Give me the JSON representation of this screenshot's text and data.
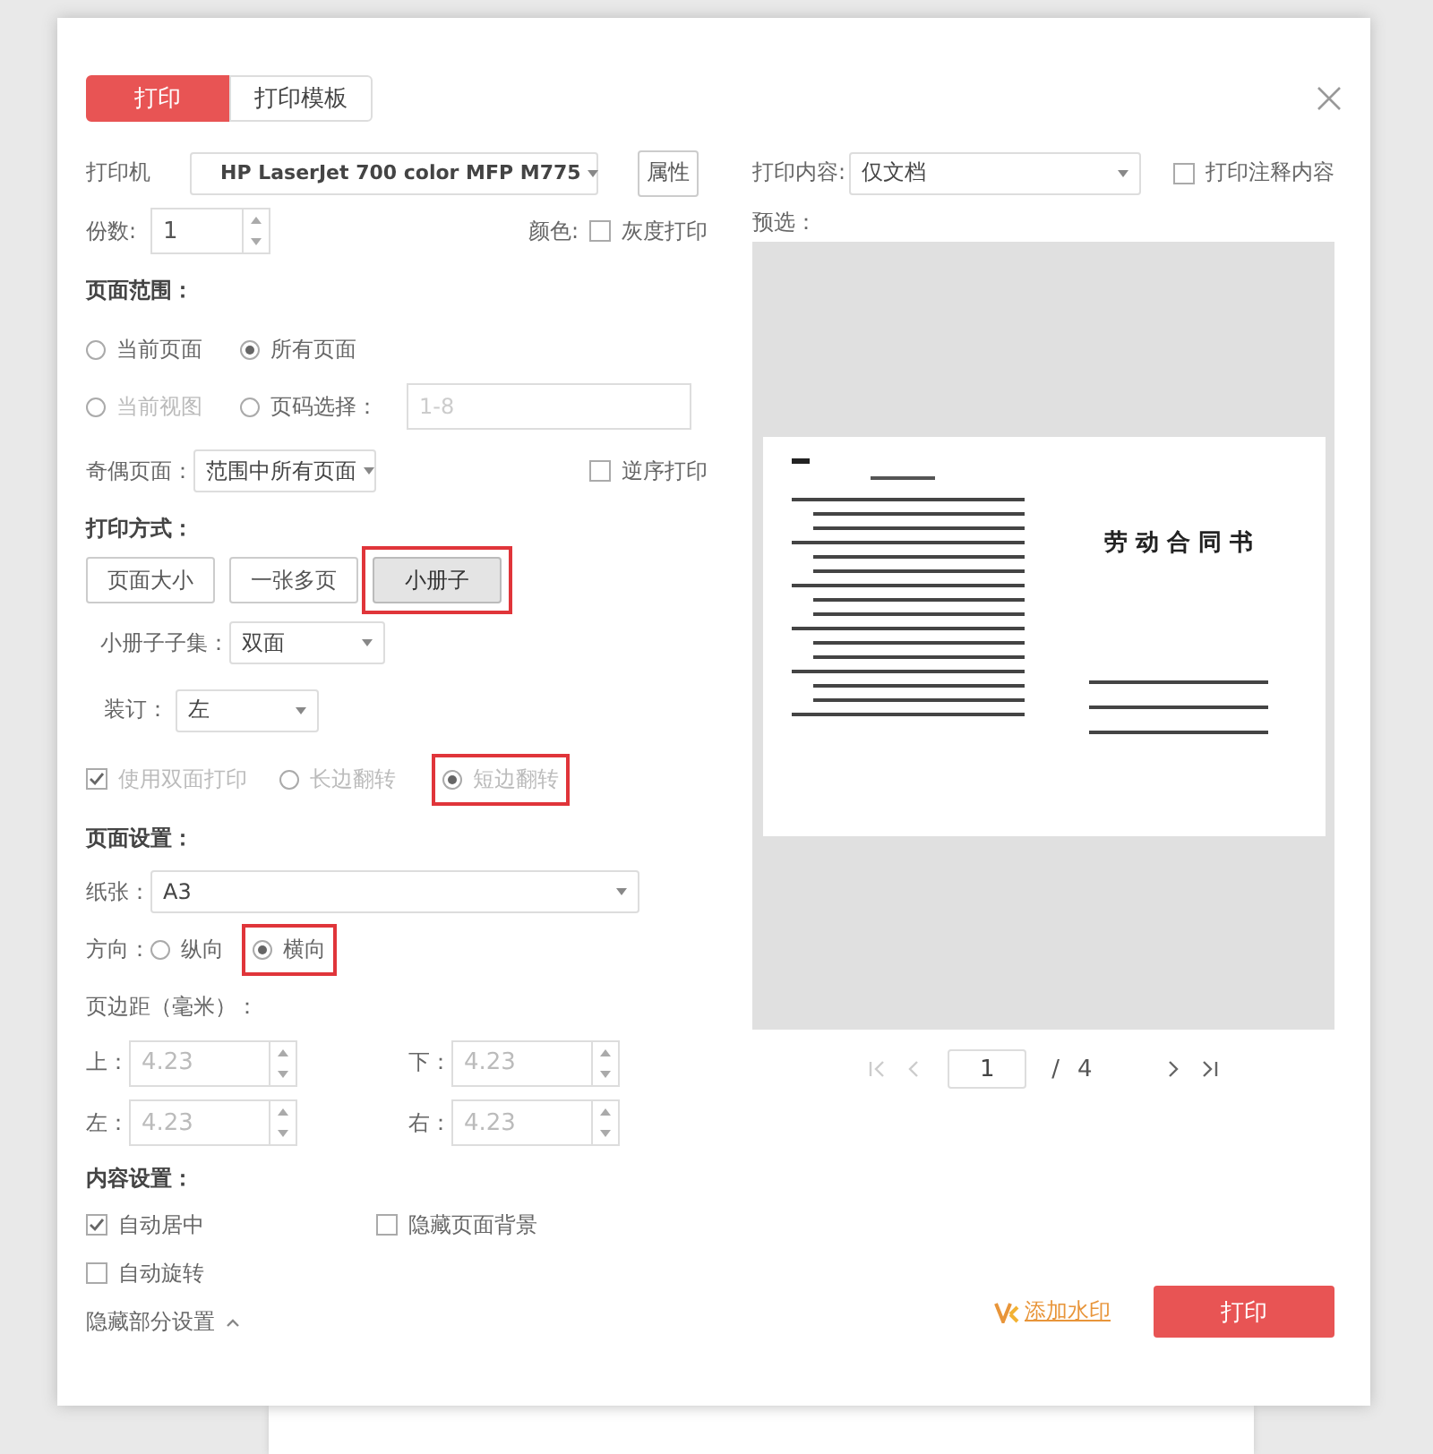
{
  "tabs": [
    {
      "label": "打印",
      "selected": true
    },
    {
      "label": "打印模板",
      "selected": false
    }
  ],
  "printer": {
    "label": "打印机",
    "value": "HP LaserJet 700 color MFP M775",
    "button": "属性"
  },
  "copies": {
    "label": "份数:",
    "value": "1"
  },
  "color": {
    "label": "颜色:",
    "option": {
      "label": "灰度打印",
      "checked": false
    }
  },
  "page_range": {
    "title": "页面范围：",
    "options": [
      {
        "label": "当前页面",
        "selected": false,
        "disabled": false
      },
      {
        "label": "所有页面",
        "selected": true,
        "disabled": false
      },
      {
        "label": "当前视图",
        "selected": false,
        "disabled": true
      },
      {
        "label": "页码选择：",
        "selected": false,
        "disabled": false
      }
    ],
    "pages_placeholder": "1-8"
  },
  "odd_even": {
    "label": "奇偶页面：",
    "value": "范围中所有页面"
  },
  "reverse": {
    "label": "逆序打印",
    "checked": false
  },
  "print_mode": {
    "title": "打印方式：",
    "buttons": [
      {
        "label": "页面大小",
        "selected": false,
        "highlighted": false
      },
      {
        "label": "一张多页",
        "selected": false,
        "highlighted": false
      },
      {
        "label": "小册子",
        "selected": true,
        "highlighted": true
      }
    ]
  },
  "booklet_subset": {
    "label": "小册子子集：",
    "value": "双面"
  },
  "binding": {
    "label": "装订：",
    "value": "左"
  },
  "duplex": {
    "label": "使用双面打印",
    "checked": true,
    "disabled": true
  },
  "flip": [
    {
      "label": "长边翻转",
      "selected": false,
      "highlighted": false
    },
    {
      "label": "短边翻转",
      "selected": true,
      "highlighted": true
    }
  ],
  "page_setup": {
    "title": "页面设置：",
    "paper": {
      "label": "纸张：",
      "value": "A3"
    },
    "orientation": {
      "label": "方向：",
      "options": [
        {
          "label": "纵向",
          "selected": false,
          "highlighted": false
        },
        {
          "label": "横向",
          "selected": true,
          "highlighted": true
        }
      ]
    }
  },
  "margins": {
    "title": "页边距（毫米）：",
    "disabled": true,
    "fields": [
      {
        "label": "上：",
        "value": "4.23"
      },
      {
        "label": "下：",
        "value": "4.23"
      },
      {
        "label": "左：",
        "value": "4.23"
      },
      {
        "label": "右：",
        "value": "4.23"
      }
    ]
  },
  "content": {
    "title": "内容设置：",
    "options": [
      {
        "label": "自动居中",
        "checked": true
      },
      {
        "label": "隐藏页面背景",
        "checked": false
      },
      {
        "label": "自动旋转",
        "checked": false
      }
    ]
  },
  "collapse": "隐藏部分设置",
  "print_content": {
    "label": "打印内容:",
    "value": "仅文档"
  },
  "print_comments": {
    "label": "打印注释内容",
    "checked": false
  },
  "preview": {
    "label": "预选：",
    "document_title": "劳 动 合 同 书"
  },
  "pager": {
    "current": "1",
    "separator": "/",
    "total": "4"
  },
  "watermark_link": "添加水印",
  "print_button": "打印"
}
